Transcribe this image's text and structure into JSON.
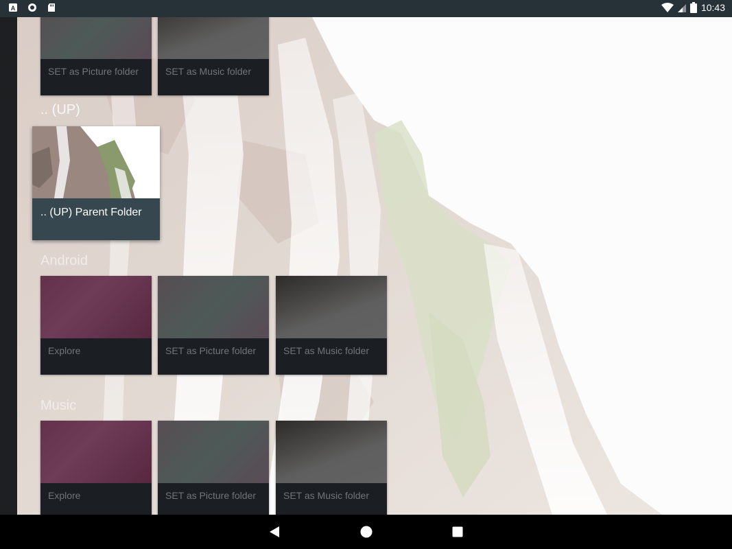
{
  "status_bar": {
    "time": "10:43",
    "left_icons": [
      "a-box-icon",
      "circle-icon",
      "sd-card-icon"
    ],
    "right_icons": [
      "wifi-icon",
      "signal-icon",
      "battery-icon"
    ]
  },
  "sections": {
    "top": {
      "cards": [
        {
          "label": "SET as Picture folder"
        },
        {
          "label": "SET as Music folder"
        }
      ]
    },
    "up": {
      "title": ".. (UP)",
      "card_label": ".. (UP) Parent Folder"
    },
    "android": {
      "title": "Android",
      "cards": [
        {
          "label": "Explore"
        },
        {
          "label": "SET as Picture folder"
        },
        {
          "label": "SET as Music folder"
        }
      ]
    },
    "music": {
      "title": "Music",
      "cards": [
        {
          "label": "Explore"
        },
        {
          "label": "SET as Picture folder"
        },
        {
          "label": "SET as Music folder"
        }
      ]
    }
  },
  "nav_bar": {
    "buttons": [
      "back-icon",
      "home-icon",
      "recents-icon"
    ]
  }
}
